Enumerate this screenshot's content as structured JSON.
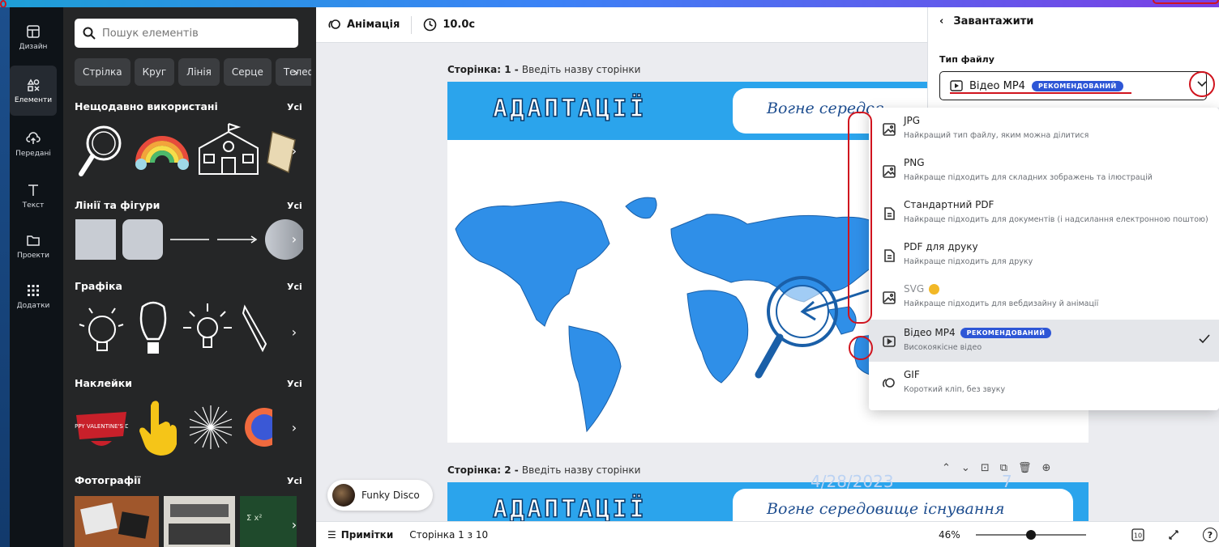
{
  "rail": {
    "items": [
      {
        "label": "Дизайн",
        "icon": "layout-icon"
      },
      {
        "label": "Елементи",
        "icon": "shapes-icon"
      },
      {
        "label": "Передані",
        "icon": "upload-cloud-icon"
      },
      {
        "label": "Текст",
        "icon": "text-icon"
      },
      {
        "label": "Проекти",
        "icon": "folder-icon"
      },
      {
        "label": "Додатки",
        "icon": "apps-grid-icon"
      }
    ]
  },
  "panel": {
    "search_placeholder": "Пошук елементів",
    "chips": [
      "Стрілка",
      "Круг",
      "Лінія",
      "Серце",
      "Телеф"
    ],
    "sections": [
      {
        "title": "Нещодавно використані",
        "all": "Усі"
      },
      {
        "title": "Лінії та фігури",
        "all": "Усі"
      },
      {
        "title": "Графіка",
        "all": "Усі"
      },
      {
        "title": "Наклейки",
        "all": "Усі"
      },
      {
        "title": "Фотографії",
        "all": "Усі"
      }
    ],
    "sticker_text": "HAPPY VALENTINE'S DAY"
  },
  "toolbar": {
    "animation": "Анімація",
    "duration": "10.0с"
  },
  "canvas": {
    "page1_label_bold": "Сторінка: 1 - ",
    "page1_label_rest": "Введіть назву сторінки",
    "page2_label_bold": "Сторінка: 2 - ",
    "page2_label_rest": "Введіть назву сторінки",
    "slide_title": "АДАПТАЦІЇ",
    "slide1_subtitle": "Вогне середов",
    "slide2_subtitle": "Вогне середовище існування",
    "watermark_date": "4/28/2023",
    "watermark_page": "7",
    "audio_track": "Funky Disco"
  },
  "bottom": {
    "notes": "Примітки",
    "page_info": "Сторінка 1 з 10",
    "zoom": "46%",
    "zoom_fraction": 0.46,
    "grid_count": "10"
  },
  "download": {
    "back_title": "Завантажити",
    "file_type_label": "Тип файлу",
    "selected": "Відео MP4",
    "recommended_badge": "РЕКОМЕНДОВАНИЙ",
    "options": [
      {
        "title": "JPG",
        "desc": "Найкращий тип файлу, яким можна ділитися",
        "icon": "image-icon"
      },
      {
        "title": "PNG",
        "desc": "Найкраще підходить для складних зображень та ілюстрацій",
        "icon": "image-icon"
      },
      {
        "title": "Стандартний PDF",
        "desc": "Найкраще підходить для документів (і надсилання електронною поштою)",
        "icon": "document-icon"
      },
      {
        "title": "PDF для друку",
        "desc": "Найкраще підходить для друку",
        "icon": "document-icon"
      },
      {
        "title": "SVG",
        "desc": "Найкраще підходить для вебдизайну й анімації",
        "icon": "image-icon"
      },
      {
        "title": "Відео MP4",
        "desc": "Високоякісне відео",
        "icon": "video-icon"
      },
      {
        "title": "GIF",
        "desc": "Короткий кліп, без звуку",
        "icon": "gif-icon"
      }
    ]
  },
  "colors": {
    "accent": "#2d56d6",
    "slide_banner": "#2ba4ec",
    "annotation_red": "#d0141e",
    "panel_bg": "#252627"
  }
}
